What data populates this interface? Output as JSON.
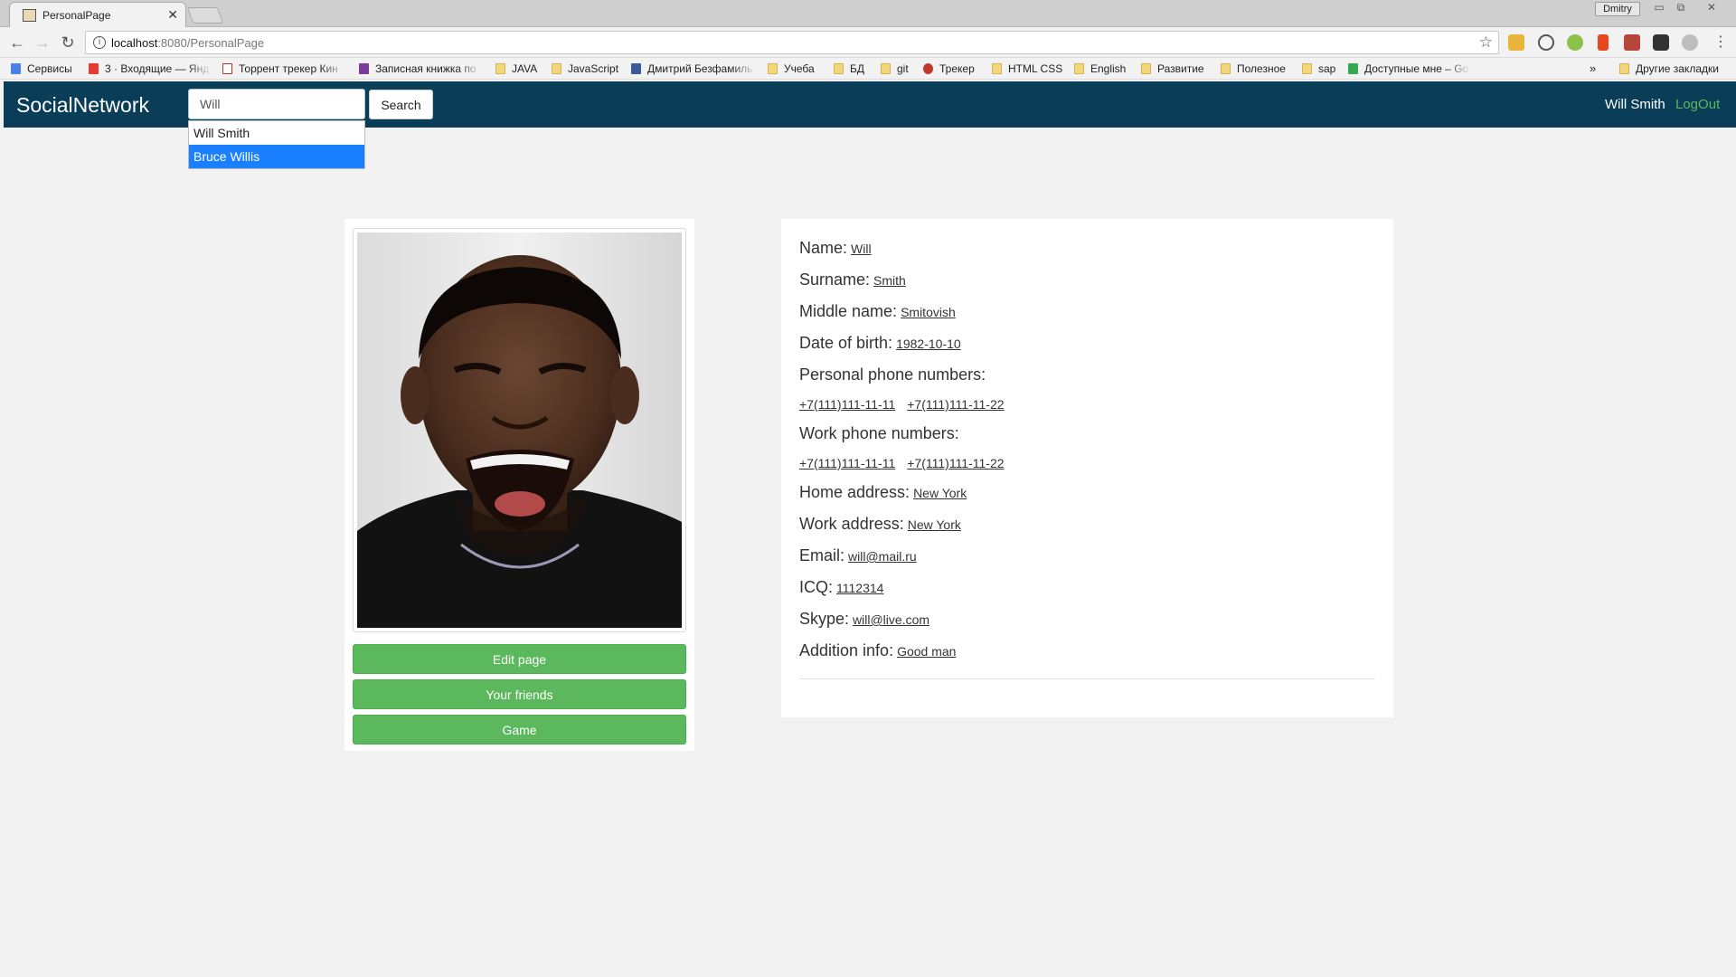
{
  "browser": {
    "tab_title": "PersonalPage",
    "url_host": "localhost",
    "url_path": ":8080/PersonalPage",
    "profile_name": "Dmitry",
    "bookmarks": [
      {
        "label": "Сервисы",
        "icon": "apps-grid-icon"
      },
      {
        "label": "3 · Входящие — Янд",
        "icon": "mail-icon"
      },
      {
        "label": "Торрент трекер Кин",
        "icon": "k-icon"
      },
      {
        "label": "Записная книжка по",
        "icon": "onenote-icon"
      },
      {
        "label": "JAVA",
        "icon": "folder-icon"
      },
      {
        "label": "JavaScript",
        "icon": "folder-icon"
      },
      {
        "label": "Дмитрий Безфамиль",
        "icon": "video-icon"
      },
      {
        "label": "Учеба",
        "icon": "folder-icon"
      },
      {
        "label": "БД",
        "icon": "folder-icon"
      },
      {
        "label": "git",
        "icon": "folder-icon"
      },
      {
        "label": "Трекер",
        "icon": "tracker-icon"
      },
      {
        "label": "HTML CSS",
        "icon": "folder-icon"
      },
      {
        "label": "English",
        "icon": "folder-icon"
      },
      {
        "label": "Развитие",
        "icon": "folder-icon"
      },
      {
        "label": "Полезное",
        "icon": "folder-icon"
      },
      {
        "label": "sap",
        "icon": "folder-icon"
      },
      {
        "label": "Доступные мне – Go",
        "icon": "drive-icon"
      },
      {
        "label": "Другие закладки",
        "icon": "folder-icon"
      }
    ]
  },
  "nav": {
    "brand": "SocialNetwork",
    "search_value": "Will",
    "search_button": "Search",
    "user_name": "Will Smith",
    "logout": "LogOut"
  },
  "suggestions": [
    "Will Smith",
    "Bruce Willis"
  ],
  "profile": {
    "buttons": {
      "edit": "Edit page",
      "friends": "Your friends",
      "game": "Game"
    },
    "fields": {
      "name": {
        "label": "Name:",
        "value": "Will"
      },
      "surname": {
        "label": "Surname:",
        "value": "Smith"
      },
      "middle": {
        "label": "Middle name:",
        "value": "Smitovish"
      },
      "dob": {
        "label": "Date of birth:",
        "value": "1982-10-10"
      },
      "personal_phones_label": "Personal phone numbers:",
      "personal_phones": [
        "+7(111)111-11-11",
        "+7(111)111-11-22"
      ],
      "work_phones_label": "Work phone numbers:",
      "work_phones": [
        "+7(111)111-11-11",
        "+7(111)111-11-22"
      ],
      "home": {
        "label": "Home address:",
        "value": "New York"
      },
      "work": {
        "label": "Work address:",
        "value": "New York"
      },
      "email": {
        "label": "Email:",
        "value": "will@mail.ru"
      },
      "icq": {
        "label": "ICQ:",
        "value": "1112314"
      },
      "skype": {
        "label": "Skype:",
        "value": "will@live.com"
      },
      "addition": {
        "label": "Addition info:",
        "value": "Good man"
      }
    }
  },
  "colors": {
    "navbar": "#0a3e58",
    "button_green": "#5cb85c",
    "logout": "#5cb85c",
    "suggestion_active": "#1a80ff"
  }
}
